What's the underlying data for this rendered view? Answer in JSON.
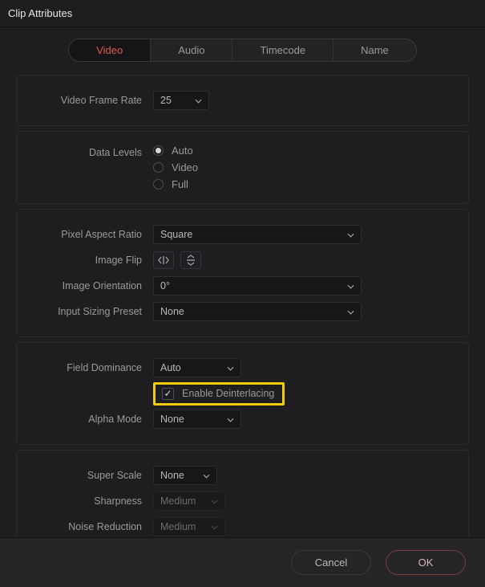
{
  "title": "Clip Attributes",
  "tabs": {
    "video": "Video",
    "audio": "Audio",
    "timecode": "Timecode",
    "name": "Name"
  },
  "panel1": {
    "frameRate": {
      "label": "Video Frame Rate",
      "value": "25"
    }
  },
  "panel2": {
    "dataLevels": {
      "label": "Data Levels",
      "opt_auto": "Auto",
      "opt_video": "Video",
      "opt_full": "Full"
    }
  },
  "panel3": {
    "par": {
      "label": "Pixel Aspect Ratio",
      "value": "Square"
    },
    "flip": {
      "label": "Image Flip"
    },
    "orient": {
      "label": "Image Orientation",
      "value": "0°"
    },
    "preset": {
      "label": "Input Sizing Preset",
      "value": "None"
    }
  },
  "panel4": {
    "field": {
      "label": "Field Dominance",
      "value": "Auto"
    },
    "deint": {
      "label": "Enable Deinterlacing"
    },
    "alpha": {
      "label": "Alpha Mode",
      "value": "None"
    }
  },
  "panel5": {
    "scale": {
      "label": "Super Scale",
      "value": "None"
    },
    "sharp": {
      "label": "Sharpness",
      "value": "Medium"
    },
    "noise": {
      "label": "Noise Reduction",
      "value": "Medium"
    }
  },
  "buttons": {
    "cancel": "Cancel",
    "ok": "OK"
  }
}
